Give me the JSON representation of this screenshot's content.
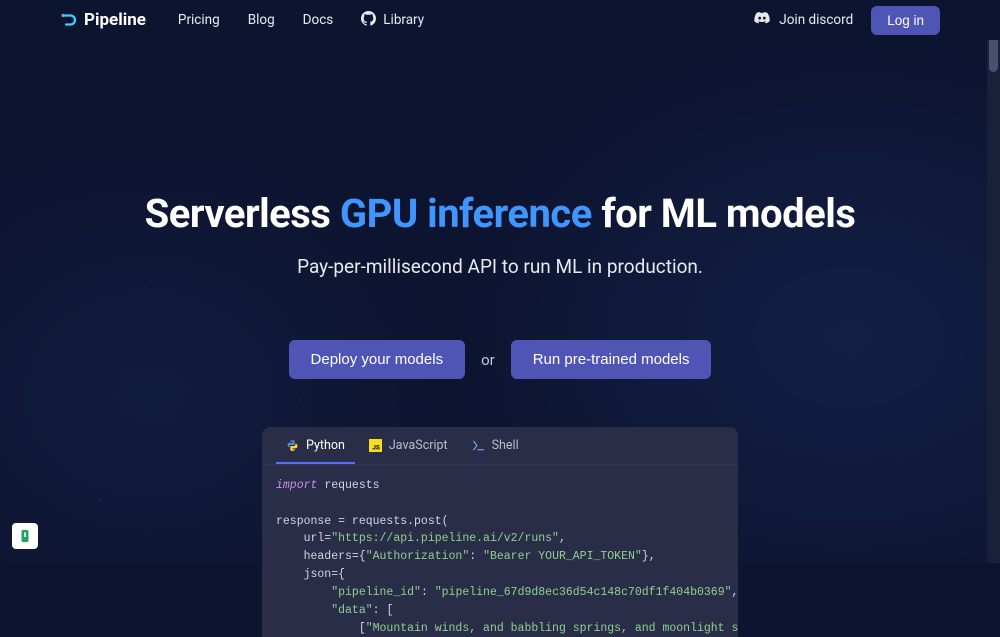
{
  "brand": "Pipeline",
  "nav": {
    "pricing": "Pricing",
    "blog": "Blog",
    "docs": "Docs",
    "library": "Library",
    "discord": "Join discord",
    "login": "Log in"
  },
  "hero": {
    "title_pre": "Serverless ",
    "title_accent": "GPU inference",
    "title_post": " for ML models",
    "subtitle": "Pay-per-millisecond API to run ML in production."
  },
  "cta": {
    "deploy": "Deploy your models",
    "or": "or",
    "run": "Run pre-trained models"
  },
  "code": {
    "tabs": {
      "python": "Python",
      "javascript": "JavaScript",
      "shell": "Shell"
    },
    "line1_kw": "import",
    "line1_rest": " requests",
    "line3": "response = requests.post(",
    "line4_pre": "    url=",
    "line4_str": "\"https://api.pipeline.ai/v2/runs\"",
    "line4_post": ",",
    "line5_pre": "    headers={",
    "line5_k": "\"Authorization\"",
    "line5_sep": ": ",
    "line5_v": "\"Bearer YOUR_API_TOKEN\"",
    "line5_post": "},",
    "line6": "    json={",
    "line7_pre": "        ",
    "line7_k": "\"pipeline_id\"",
    "line7_sep": ": ",
    "line7_v": "\"pipeline_67d9d8ec36d54c148c70df1f404b0369\"",
    "line7_post": ",",
    "line8_pre": "        ",
    "line8_k": "\"data\"",
    "line8_post": ": [",
    "line9_pre": "            [",
    "line9_str": "\"Mountain winds, and babbling springs, and moonlight seas\"",
    "line9_post": "],"
  }
}
